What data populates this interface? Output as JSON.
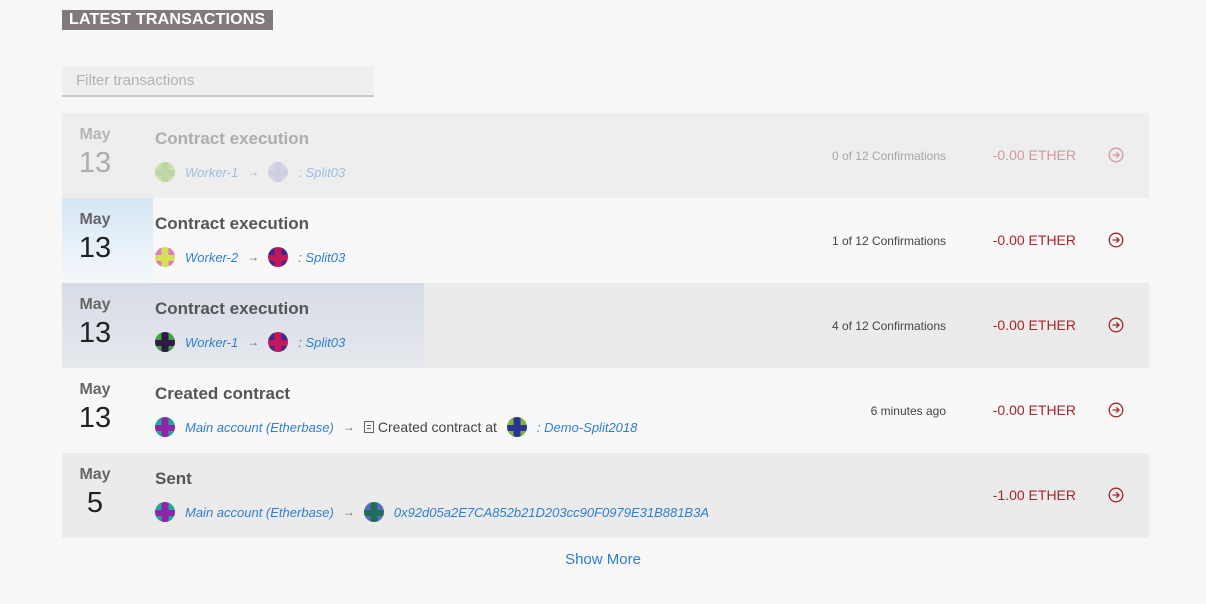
{
  "header": {
    "title": "LATEST TRANSACTIONS"
  },
  "filter": {
    "placeholder": "Filter transactions",
    "value": ""
  },
  "transactions": [
    {
      "month": "May",
      "day": "13",
      "title": "Contract execution",
      "from": "Worker-1",
      "from_avatar": [
        "#9ccc65",
        "#7cb342"
      ],
      "to": ": Split03",
      "to_avatar": [
        "#c5b7d6",
        "#9fa8da"
      ],
      "status": "0 of 12 Confirmations",
      "amount": "-0.00 ETHER",
      "confirmations": 0
    },
    {
      "month": "May",
      "day": "13",
      "title": "Contract execution",
      "from": "Worker-2",
      "from_avatar": [
        "#e07ac8",
        "#d4e157"
      ],
      "to": ": Split03",
      "to_avatar": [
        "#3f2a8c",
        "#c2185b"
      ],
      "status": "1 of 12 Confirmations",
      "amount": "-0.00 ETHER",
      "confirmations": 1
    },
    {
      "month": "May",
      "day": "13",
      "title": "Contract execution",
      "from": "Worker-1",
      "from_avatar": [
        "#43a047",
        "#2e1a47"
      ],
      "to": ": Split03",
      "to_avatar": [
        "#3f2a8c",
        "#c2185b"
      ],
      "status": "4 of 12 Confirmations",
      "amount": "-0.00 ETHER",
      "confirmations": 4
    },
    {
      "month": "May",
      "day": "13",
      "title": "Created contract",
      "from": "Main account (Etherbase)",
      "from_avatar": [
        "#26a69a",
        "#8e24aa"
      ],
      "middle": "Created contract at",
      "to": ": Demo-Split2018",
      "to_avatar": [
        "#7cb342",
        "#283593"
      ],
      "status": "6 minutes ago",
      "amount": "-0.00 ETHER"
    },
    {
      "month": "May",
      "day": "5",
      "title": "Sent",
      "from": "Main account (Etherbase)",
      "from_avatar": [
        "#26a69a",
        "#8e24aa"
      ],
      "to": "0x92d05a2E7CA852b21D203cc90F0979E31B881B3A",
      "to_avatar": [
        "#5c6bc0",
        "#1e6e5a"
      ],
      "status": "",
      "amount": "-1.00 ETHER"
    }
  ],
  "footer": {
    "show_more": "Show More"
  },
  "colors": {
    "accent": "#2f7fcf",
    "amount": "#a8252b",
    "heading_bg": "#827a7a"
  }
}
